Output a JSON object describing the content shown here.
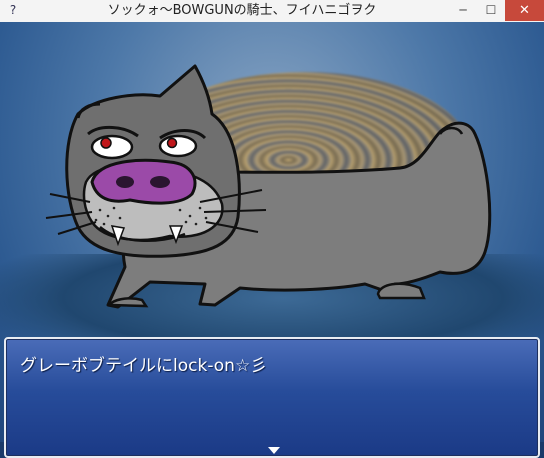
{
  "window": {
    "title": "ソックォ〜BOWGUNの騎士、フイハニゴヲク",
    "app_icon": "?",
    "min_glyph": "─",
    "max_glyph": "☐",
    "close_glyph": "✕"
  },
  "battle": {
    "enemy_name": "グレーボブテイル",
    "message": "グレーボブテイルにlock-on☆彡"
  },
  "colors": {
    "message_window": "#2a4fa0",
    "enemy_body": "#7d7d7d",
    "enemy_nose": "#9b4aa8",
    "close_button": "#c7493b"
  },
  "icons": [
    "app-help-icon",
    "minimize-icon",
    "maximize-icon",
    "close-icon",
    "continue-arrow-icon"
  ]
}
